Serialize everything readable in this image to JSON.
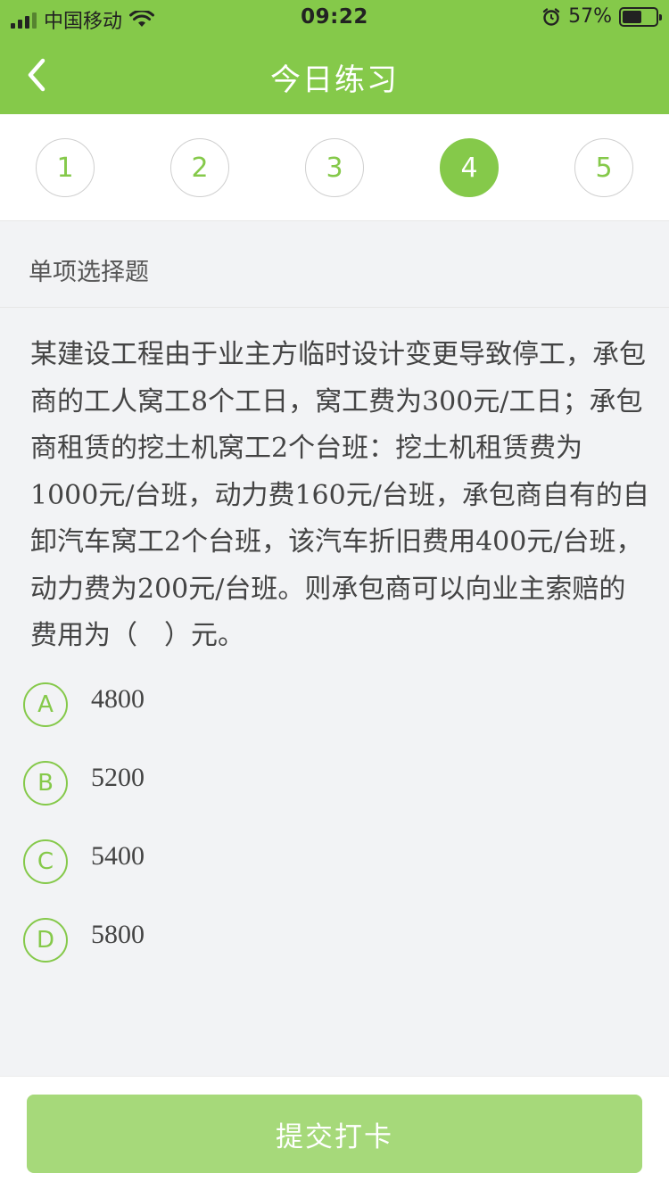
{
  "status_bar": {
    "carrier": "中国移动",
    "time": "09:22",
    "battery": "57%",
    "battery_level": 0.57
  },
  "nav": {
    "title": "今日练习",
    "back_icon": "chevron-left-icon"
  },
  "question_nav": {
    "items": [
      "1",
      "2",
      "3",
      "4",
      "5"
    ],
    "active_index": 3
  },
  "question": {
    "type_label": "单项选择题",
    "text": "某建设工程由于业主方临时设计变更导致停工，承包商的工人窝工8个工日，窝工费为300元/工日；承包商租赁的挖土机窝工2个台班：挖土机租赁费为1000元/台班，动力费160元/台班，承包商自有的自卸汽车窝工2个台班，该汽车折旧费用400元/台班，动力费为200元/台班。则承包商可以向业主索赔的费用为（　）元。",
    "options": [
      {
        "letter": "A",
        "text": "4800"
      },
      {
        "letter": "B",
        "text": "5200"
      },
      {
        "letter": "C",
        "text": "5400"
      },
      {
        "letter": "D",
        "text": "5800"
      }
    ]
  },
  "footer": {
    "submit_label": "提交打卡"
  },
  "colors": {
    "accent": "#85c94a",
    "submit_bg": "#a6d97a"
  }
}
